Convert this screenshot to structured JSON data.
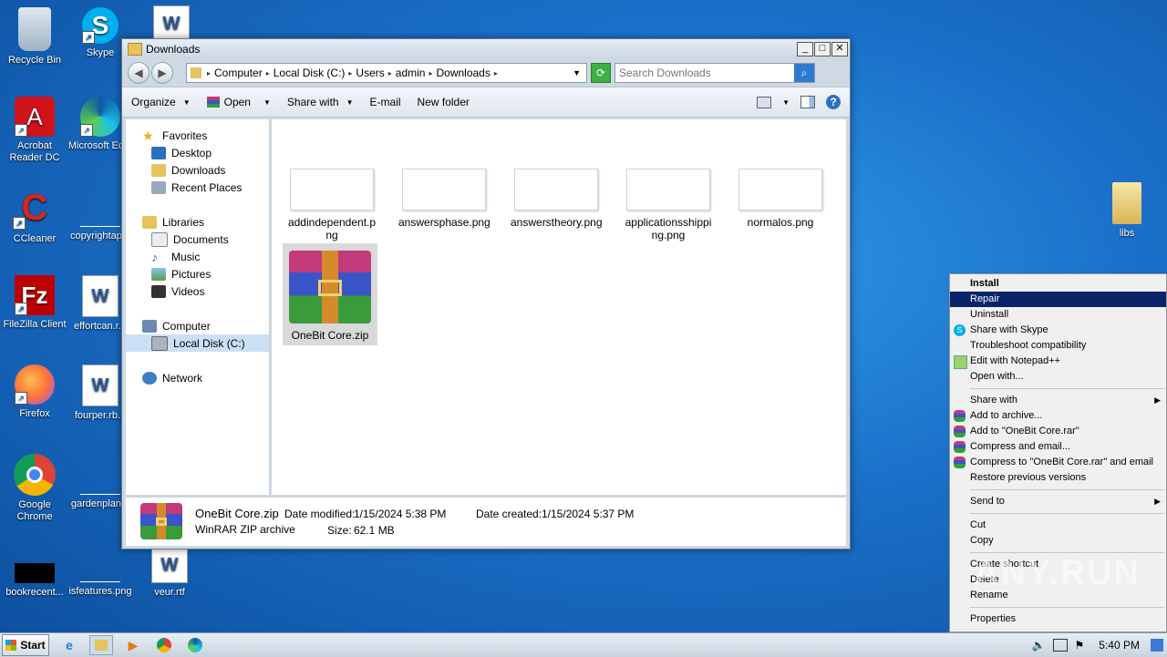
{
  "desktop": {
    "icons": [
      {
        "label": "Recycle Bin"
      },
      {
        "label": "Skype"
      },
      {
        "label": "Acrobat Reader DC"
      },
      {
        "label": "Microsoft Ed..."
      },
      {
        "label": "CCleaner"
      },
      {
        "label": "copyrightap..."
      },
      {
        "label": "FileZilla Client"
      },
      {
        "label": "effortcan.r..."
      },
      {
        "label": "Firefox"
      },
      {
        "label": "fourper.rb..."
      },
      {
        "label": "Google Chrome"
      },
      {
        "label": "gardenplan..."
      },
      {
        "label": "bookrecent..."
      },
      {
        "label": "isfeatures.png"
      },
      {
        "label": "veur.rtf"
      },
      {
        "label": "libs"
      }
    ]
  },
  "window": {
    "title": "Downloads",
    "breadcrumb": [
      "Computer",
      "Local Disk (C:)",
      "Users",
      "admin",
      "Downloads"
    ],
    "search_placeholder": "Search Downloads",
    "toolbar": {
      "organize": "Organize",
      "open": "Open",
      "share_with": "Share with",
      "email": "E-mail",
      "new_folder": "New folder"
    },
    "nav": {
      "favorites": "Favorites",
      "desktop": "Desktop",
      "downloads": "Downloads",
      "recent_places": "Recent Places",
      "libraries": "Libraries",
      "documents": "Documents",
      "music": "Music",
      "pictures": "Pictures",
      "videos": "Videos",
      "computer": "Computer",
      "local_disk": "Local Disk (C:)",
      "network": "Network"
    },
    "files": [
      {
        "name": "addindependent.png"
      },
      {
        "name": "answersphase.png"
      },
      {
        "name": "answerstheory.png"
      },
      {
        "name": "applicationsshipping.png"
      },
      {
        "name": "normalos.png"
      },
      {
        "name": "OneBit Core.zip"
      }
    ],
    "status": {
      "name": "OneBit Core.zip",
      "type": "WinRAR ZIP archive",
      "modified_label": "Date modified:",
      "modified_value": "1/15/2024 5:38 PM",
      "created_label": "Date created:",
      "created_value": "1/15/2024 5:37 PM",
      "size_label": "Size:",
      "size_value": "62.1 MB"
    }
  },
  "context_menu": {
    "install": "Install",
    "repair": "Repair",
    "uninstall": "Uninstall",
    "share_skype": "Share with Skype",
    "troubleshoot": "Troubleshoot compatibility",
    "notepad": "Edit with Notepad++",
    "open_with": "Open with...",
    "share_with": "Share with",
    "add_archive": "Add to archive...",
    "add_rar": "Add to \"OneBit Core.rar\"",
    "compress_email": "Compress and email...",
    "compress_rar_email": "Compress to \"OneBit Core.rar\" and email",
    "restore": "Restore previous versions",
    "send_to": "Send to",
    "cut": "Cut",
    "copy": "Copy",
    "create_shortcut": "Create shortcut",
    "delete": "Delete",
    "rename": "Rename",
    "properties": "Properties"
  },
  "taskbar": {
    "start": "Start",
    "clock": "5:40 PM"
  },
  "watermark": "ANY.RUN"
}
